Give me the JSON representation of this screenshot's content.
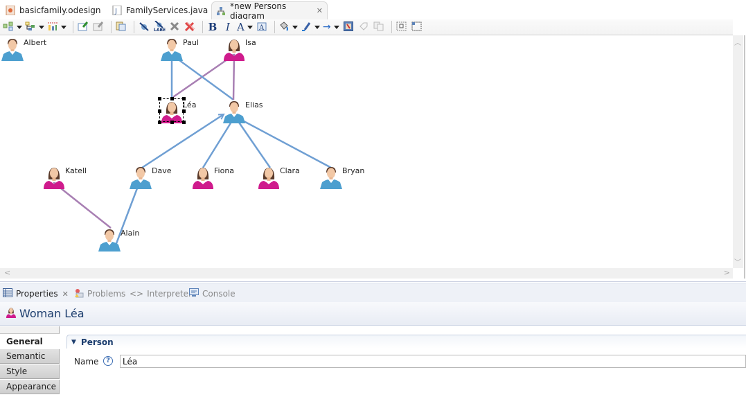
{
  "editor_tabs": [
    {
      "label": "basicfamily.odesign",
      "icon": "odesign-file-icon",
      "active": false
    },
    {
      "label": "FamilyServices.java",
      "icon": "java-file-icon",
      "active": false
    },
    {
      "label": "*new Persons diagram",
      "icon": "diagram-icon",
      "active": true,
      "close": "✕"
    }
  ],
  "toolbar": {
    "items": [
      "arrange-all-icon",
      "select-all-icon",
      "layout-icon",
      "pin-icon",
      "unpin-icon",
      "copy-format-icon",
      "hide-element-icon",
      "hide-label-icon",
      "delete-from-diagram-icon",
      "delete-from-model-icon",
      "bold-icon",
      "italic-icon",
      "font-color-icon",
      "text-style-icon",
      "fill-color-icon",
      "line-color-icon",
      "line-style-icon",
      "image-icon",
      "reset-style-icon",
      "copy-appearance-icon",
      "distribute-icon",
      "size-icon"
    ],
    "bold_glyph": "B",
    "italic_glyph": "I",
    "font_color_glyph": "A",
    "arrow_glyph": "→"
  },
  "diagram": {
    "colors": {
      "male_edge": "#6f9fd3",
      "female_edge": "#a87fb3",
      "male_shirt": "#4d9fcf",
      "female_shirt": "#cf1b8c",
      "selection": "#000000"
    },
    "nodes": [
      {
        "id": "albert",
        "name": "Albert",
        "gender": "man"
      },
      {
        "id": "paul",
        "name": "Paul",
        "gender": "man"
      },
      {
        "id": "isa",
        "name": "Isa",
        "gender": "woman"
      },
      {
        "id": "lea",
        "name": "Léa",
        "gender": "woman",
        "selected": true
      },
      {
        "id": "elias",
        "name": "Elias",
        "gender": "man"
      },
      {
        "id": "katell",
        "name": "Katell",
        "gender": "woman"
      },
      {
        "id": "dave",
        "name": "Dave",
        "gender": "man"
      },
      {
        "id": "fiona",
        "name": "Fiona",
        "gender": "woman"
      },
      {
        "id": "clara",
        "name": "Clara",
        "gender": "woman"
      },
      {
        "id": "bryan",
        "name": "Bryan",
        "gender": "man"
      },
      {
        "id": "alain",
        "name": "Alain",
        "gender": "man"
      }
    ],
    "edges": [
      {
        "from": "lea",
        "to": "paul",
        "type": "father"
      },
      {
        "from": "lea",
        "to": "isa",
        "type": "mother"
      },
      {
        "from": "elias",
        "to": "paul",
        "type": "father"
      },
      {
        "from": "elias",
        "to": "isa",
        "type": "mother"
      },
      {
        "from": "dave",
        "to": "elias",
        "type": "father"
      },
      {
        "from": "fiona",
        "to": "elias",
        "type": "father"
      },
      {
        "from": "clara",
        "to": "elias",
        "type": "father"
      },
      {
        "from": "bryan",
        "to": "elias",
        "type": "father"
      },
      {
        "from": "alain",
        "to": "katell",
        "type": "mother"
      },
      {
        "from": "alain",
        "to": "dave",
        "type": "father"
      }
    ]
  },
  "scrollbars": {
    "up": "︿",
    "down": "﹀",
    "left": "<",
    "right": ">"
  },
  "view_tabs": [
    {
      "label": "Properties",
      "icon": "properties-icon",
      "active": true,
      "close": "✕"
    },
    {
      "label": "Problems",
      "icon": "problems-icon",
      "active": false
    },
    {
      "label": "Interpreter",
      "icon": "interpreter-icon",
      "glyph": "<>",
      "active": false
    },
    {
      "label": "Console",
      "icon": "console-icon",
      "active": false
    }
  ],
  "properties": {
    "title": "Woman Léa",
    "side_tabs": [
      "General",
      "Semantic",
      "Style",
      "Appearance"
    ],
    "active_tab": "General",
    "section": {
      "title": "Person",
      "toggle": "▼"
    },
    "fields": [
      {
        "label": "Name",
        "help": "?",
        "value": "Léa"
      }
    ]
  }
}
